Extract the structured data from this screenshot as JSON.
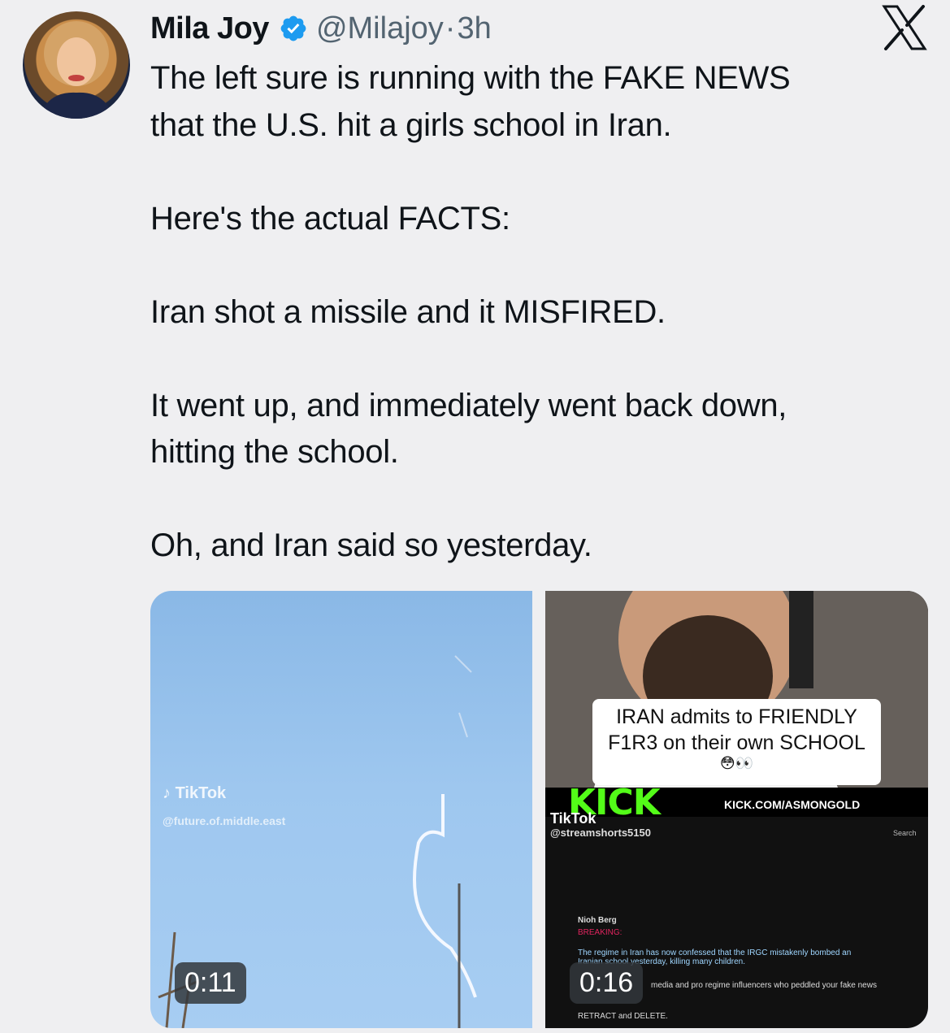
{
  "author": {
    "name": "Mila Joy",
    "handle": "@Milajoy",
    "separator": "·",
    "time": "3h",
    "avatar_icon": "profile-photo",
    "verified_icon": "verified-badge-icon"
  },
  "platform_icon": "x-logo-icon",
  "tweet": {
    "text": "The left sure is running with the FAKE NEWS\nthat the U.S. hit a girls school in Iran.\n\nHere's the actual FACTS:\n\nIran shot a missile and it MISFIRED.\n\nIt went up, and immediately went back down,\nhitting the school.\n\nOh, and Iran said so yesterday."
  },
  "media": [
    {
      "duration": "0:11",
      "watermark_label": "TikTok",
      "watermark_handle": "@future.of.middle.east"
    },
    {
      "duration": "0:16",
      "caption": "IRAN admits to FRIENDLY\nF1R3 on their own SCHOOL",
      "caption_emoji": "😳👀",
      "kick_logo": "KICK",
      "kick_url": "KICK.COM/ASMONGOLD",
      "watermark_label": "TikTok",
      "watermark_handle": "@streamshorts5150",
      "search_label": "Search",
      "inner_post_author": "Nioh Berg",
      "inner_post_tag": "BREAKING:",
      "inner_post_text": "The regime in Iran has now confessed that the IRGC mistakenly bombed an Iranian school yesterday, killing many children.",
      "inner_post_text2": "media and pro regime influencers who peddled your fake news",
      "inner_post_text3": "RETRACT and DELETE."
    }
  ],
  "colors": {
    "background": "#efeff1",
    "text": "#0f1419",
    "secondary": "#536471",
    "verified": "#1d9bf0",
    "kick_green": "#53fc18"
  }
}
